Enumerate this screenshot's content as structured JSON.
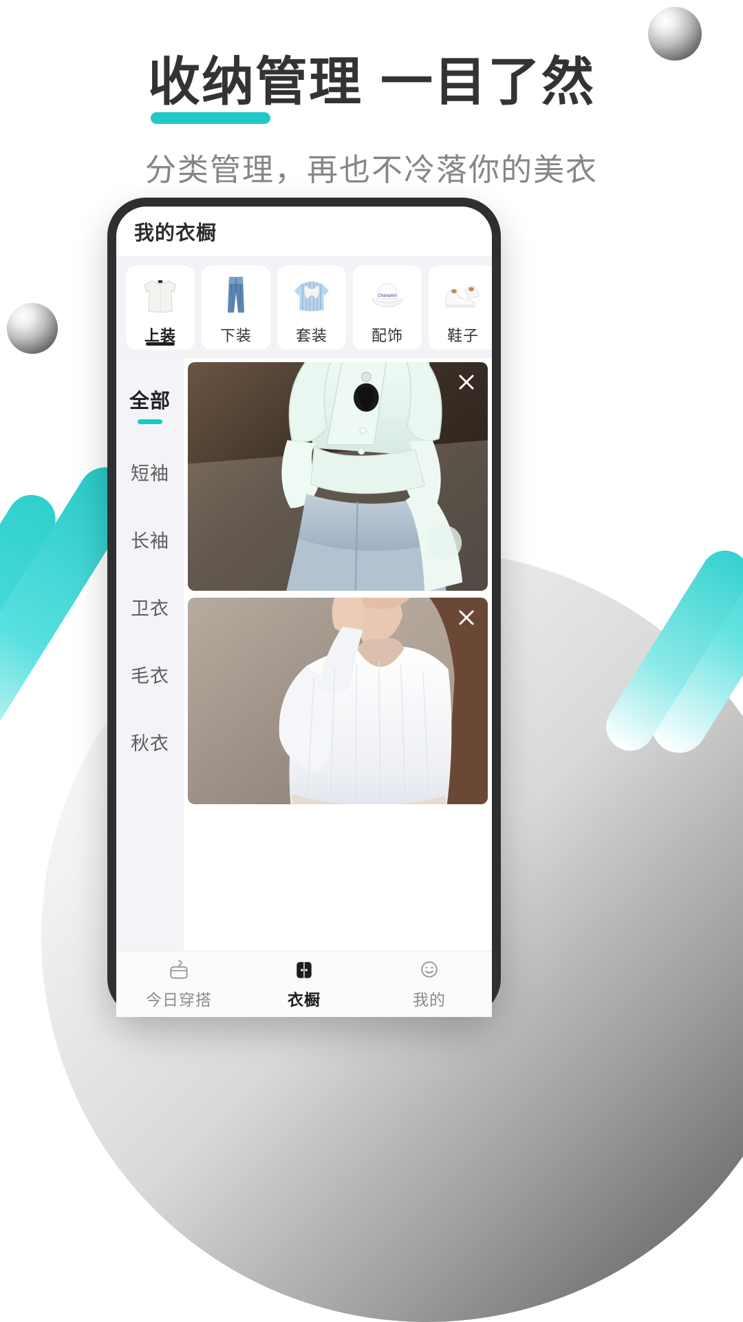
{
  "promo": {
    "headline_main": "收纳管理",
    "headline_rest": "一目了然",
    "subtitle": "分类管理，再也不冷落你的美衣",
    "accent_color": "#20c9c7",
    "text_color": "#333333",
    "subtitle_color": "#868686"
  },
  "app": {
    "header": {
      "title": "我的衣橱"
    },
    "categories": [
      {
        "label": "上装",
        "icon": "white-shirt-icon",
        "active": true
      },
      {
        "label": "下装",
        "icon": "blue-jeans-icon",
        "active": false
      },
      {
        "label": "套装",
        "icon": "striped-shirt-set-icon",
        "active": false
      },
      {
        "label": "配饰",
        "icon": "bucket-hat-icon",
        "active": false
      },
      {
        "label": "鞋子",
        "icon": "white-sneakers-icon",
        "active": false
      }
    ],
    "side_filters": [
      {
        "label": "全部",
        "active": true
      },
      {
        "label": "短袖",
        "active": false
      },
      {
        "label": "长袖",
        "active": false
      },
      {
        "label": "卫衣",
        "active": false
      },
      {
        "label": "毛衣",
        "active": false
      },
      {
        "label": "秋衣",
        "active": false
      }
    ],
    "items": [
      {
        "alt": "白色荷叶边衬衫",
        "close_label": "×"
      },
      {
        "alt": "白色针织短款上衣",
        "close_label": "×"
      }
    ],
    "tabbar": [
      {
        "label": "今日穿搭",
        "icon": "hanger-icon",
        "active": false
      },
      {
        "label": "衣橱",
        "icon": "wardrobe-icon",
        "active": true
      },
      {
        "label": "我的",
        "icon": "smiley-face-icon",
        "active": false
      }
    ],
    "colors": {
      "accent": "#17c9c7",
      "active_dark": "#1d1d1d",
      "strip_bg": "#f3f3f7"
    }
  }
}
